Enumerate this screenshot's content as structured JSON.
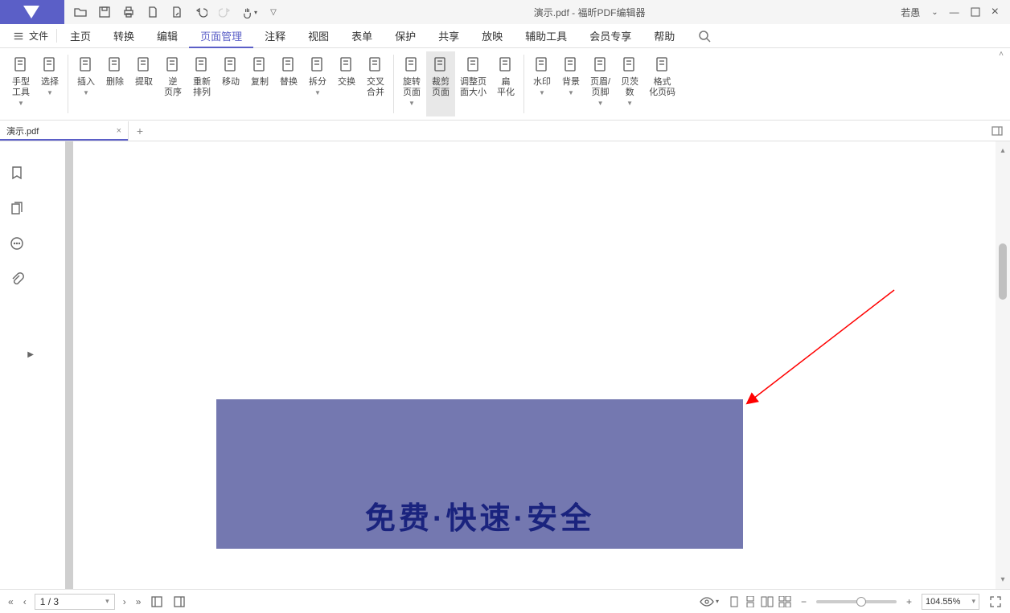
{
  "app": {
    "title": "演示.pdf - 福昕PDF编辑器",
    "user": "若愚"
  },
  "menu": {
    "file": "文件",
    "tabs": [
      "主页",
      "转换",
      "编辑",
      "页面管理",
      "注释",
      "视图",
      "表单",
      "保护",
      "共享",
      "放映",
      "辅助工具",
      "会员专享",
      "帮助"
    ],
    "active_index": 3
  },
  "ribbon": {
    "tools": [
      {
        "label": "手型\n工具",
        "caret": true
      },
      {
        "label": "选择",
        "caret": true
      },
      {
        "label": "插入",
        "caret": true
      },
      {
        "label": "删除",
        "caret": false
      },
      {
        "label": "提取",
        "caret": false
      },
      {
        "label": "逆\n页序",
        "caret": false
      },
      {
        "label": "重新\n排列",
        "caret": false
      },
      {
        "label": "移动",
        "caret": false
      },
      {
        "label": "复制",
        "caret": false
      },
      {
        "label": "替换",
        "caret": false
      },
      {
        "label": "拆分",
        "caret": true
      },
      {
        "label": "交换",
        "caret": false
      },
      {
        "label": "交叉\n合并",
        "caret": false
      },
      {
        "label": "旋转\n页面",
        "caret": true
      },
      {
        "label": "裁剪\n页面",
        "caret": false,
        "active": true
      },
      {
        "label": "调整页\n面大小",
        "caret": false
      },
      {
        "label": "扁\n平化",
        "caret": false
      },
      {
        "label": "水印",
        "caret": true
      },
      {
        "label": "背景",
        "caret": true
      },
      {
        "label": "页眉/\n页脚",
        "caret": true
      },
      {
        "label": "贝茨\n数",
        "caret": true
      },
      {
        "label": "格式\n化页码",
        "caret": false
      }
    ],
    "separators_after": [
      1,
      12,
      16
    ]
  },
  "tabs": {
    "name": "演示.pdf"
  },
  "page": {
    "content_text": "免费·快速·安全"
  },
  "status": {
    "page": "1 / 3",
    "zoom": "104.55%"
  }
}
